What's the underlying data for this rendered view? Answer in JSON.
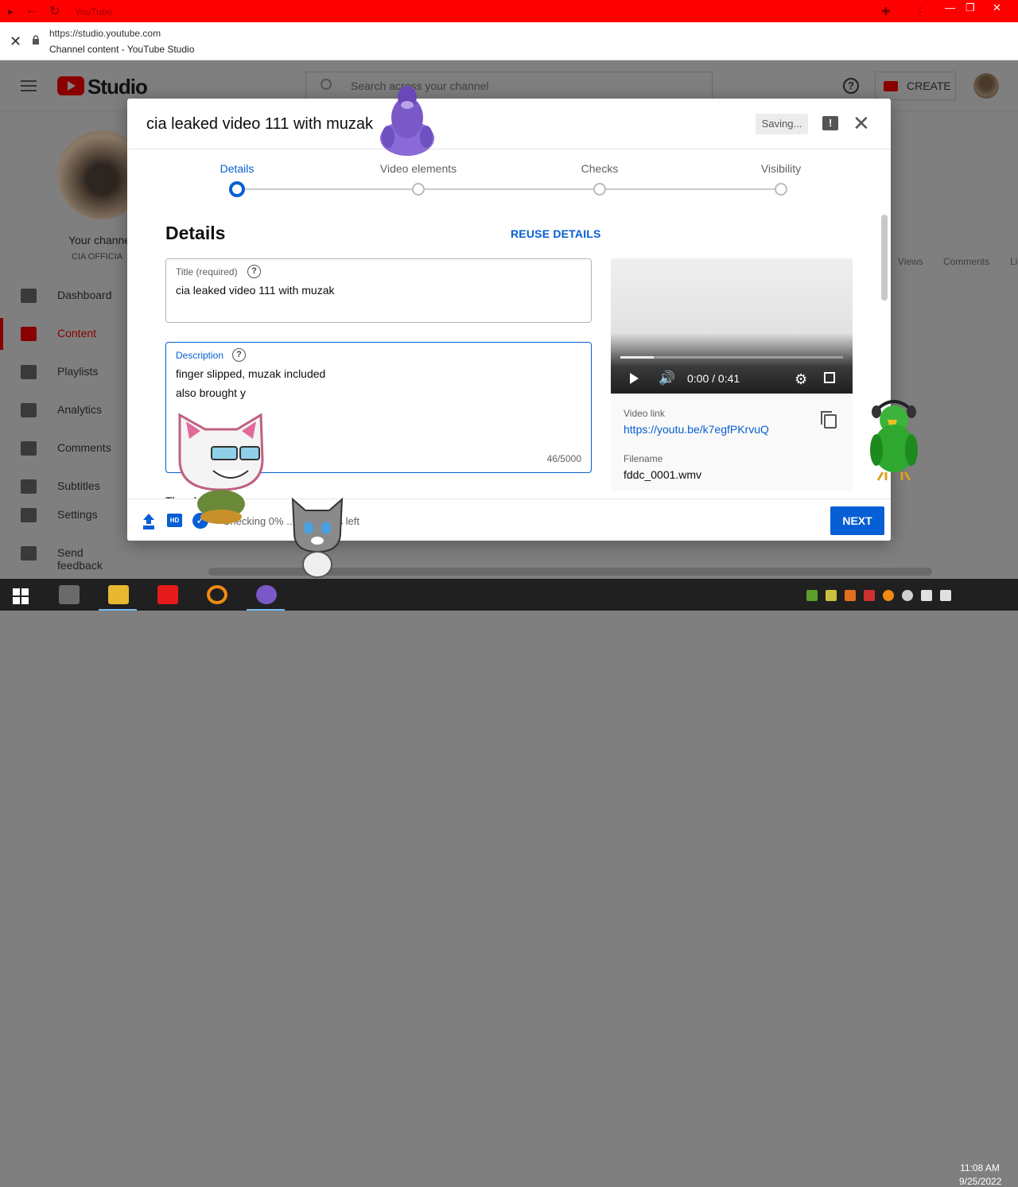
{
  "browser": {
    "window_title": "YouTube",
    "url": "https://studio.youtube.com",
    "page_title": "Channel content - YouTube Studio"
  },
  "studio": {
    "logo_text": "Studio",
    "search_placeholder": "Search across your channel",
    "create_label": "CREATE",
    "channel_label": "Your channe",
    "channel_name": "CIA OFFICIA",
    "nav": [
      {
        "label": "Dashboard",
        "icon": "dashboard-icon"
      },
      {
        "label": "Content",
        "icon": "content-icon",
        "active": true
      },
      {
        "label": "Playlists",
        "icon": "playlists-icon"
      },
      {
        "label": "Analytics",
        "icon": "analytics-icon"
      },
      {
        "label": "Comments",
        "icon": "comments-icon"
      },
      {
        "label": "Subtitles",
        "icon": "subtitles-icon"
      },
      {
        "label": "Settings",
        "icon": "settings-icon"
      },
      {
        "label": "Send feedback",
        "icon": "feedback-icon"
      }
    ],
    "columns": {
      "views": "Views",
      "comments": "Comments",
      "likes": "Li"
    }
  },
  "dialog": {
    "title": "cia leaked video 111 with muzak",
    "saving": "Saving...",
    "steps": [
      {
        "label": "Details",
        "active": true
      },
      {
        "label": "Video elements"
      },
      {
        "label": "Checks"
      },
      {
        "label": "Visibility"
      }
    ],
    "section_heading": "Details",
    "reuse_label": "REUSE DETAILS",
    "title_field": {
      "label": "Title (required)",
      "value": "cia leaked video 111 with muzak"
    },
    "description_field": {
      "label": "Description",
      "line1": "finger slipped, muzak included",
      "line2": "also brought y",
      "counter": "46/5000"
    },
    "player": {
      "time": "0:00 / 0:41",
      "progress": 0.15
    },
    "video_link_label": "Video link",
    "video_link": "https://youtu.be/k7egfPKrvuQ",
    "filename_label": "Filename",
    "filename": "fddc_0001.wmv",
    "thumbnail_partial": "Thumbn",
    "checking_text": "Checking 0% ... 3 minutes left",
    "next_label": "NEXT",
    "accent_color": "#065fd4"
  },
  "taskbar": {
    "time": "11:08 AM",
    "date": "9/25/2022"
  }
}
